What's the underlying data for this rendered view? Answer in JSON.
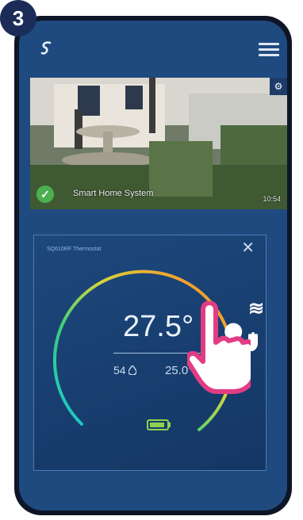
{
  "step": {
    "number": "3"
  },
  "header": {
    "logo_icon": "salus-logo-icon",
    "menu_icon": "hamburger-menu-icon"
  },
  "camera": {
    "name": "Smart Home System",
    "time": "10:54",
    "status_icon": "check-icon",
    "settings_icon": "gear-icon"
  },
  "thermostat": {
    "title": "SQ610RF Thermostat",
    "set_temperature": "27.5°",
    "humidity": "54",
    "current_temperature": "25.0°",
    "setpoint_fraction": 0.78,
    "mode_icon": "heating-icon",
    "manual_icon": "hand-icon",
    "battery_icon": "battery-icon",
    "close_icon": "close-icon"
  },
  "colors": {
    "background": "#1f4a7f",
    "accent": "#e23d83",
    "phone_frame": "#0e1526",
    "badge": "#1b2c59"
  }
}
